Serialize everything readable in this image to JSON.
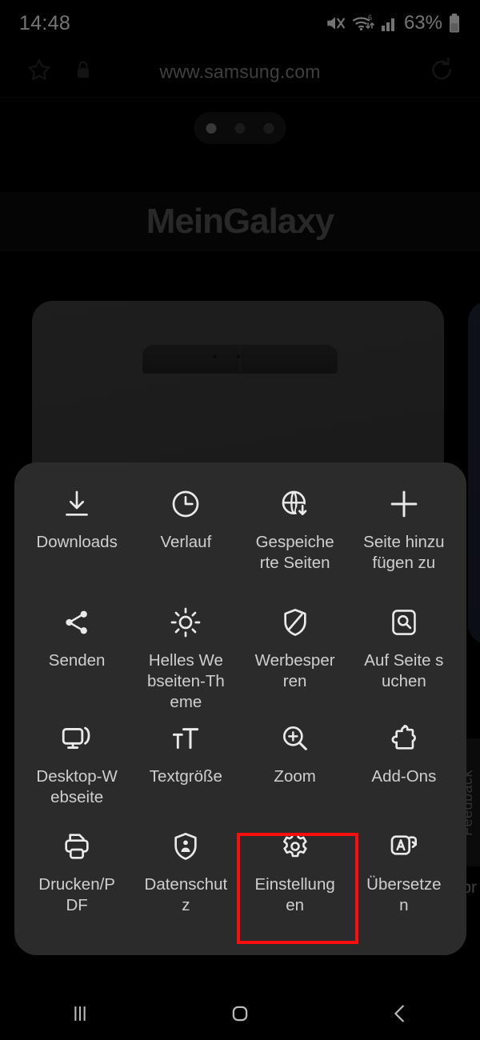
{
  "status_bar": {
    "clock": "14:48",
    "battery_percent": "63%",
    "icons": [
      "mute-icon",
      "wifi-6-icon",
      "signal-bars-icon",
      "battery-icon"
    ]
  },
  "browser_bar": {
    "bookmark_icon": "star-icon",
    "security_icon": "lock-icon",
    "url": "www.samsung.com",
    "reload_icon": "reload-icon"
  },
  "page": {
    "carousel_dots": 3,
    "active_dot_index": 0,
    "brand": "MeinGalaxy",
    "feedback_tab": "Feedback",
    "snippet": "pr"
  },
  "menu": {
    "rows": [
      [
        {
          "label": "Downloads",
          "icon": "download-icon"
        },
        {
          "label": "Verlauf",
          "icon": "history-clock-icon"
        },
        {
          "label": "Gespeicherte Seiten",
          "icon": "globe-download-icon"
        },
        {
          "label": "Seite hinzufügen zu",
          "icon": "plus-icon"
        }
      ],
      [
        {
          "label": "Senden",
          "icon": "share-icon"
        },
        {
          "label": "Helles Webseiten-Theme",
          "icon": "sun-brightness-icon"
        },
        {
          "label": "Werbesperren",
          "icon": "shield-block-icon"
        },
        {
          "label": "Auf Seite suchen",
          "icon": "find-in-page-icon"
        }
      ],
      [
        {
          "label": "Desktop-Webseite",
          "icon": "desktop-monitor-icon"
        },
        {
          "label": "Textgröße",
          "icon": "text-size-icon"
        },
        {
          "label": "Zoom",
          "icon": "zoom-in-icon"
        },
        {
          "label": "Add-Ons",
          "icon": "puzzle-piece-icon"
        }
      ],
      [
        {
          "label": "Drucken/PDF",
          "icon": "printer-icon"
        },
        {
          "label": "Datenschutz",
          "icon": "shield-person-icon"
        },
        {
          "label": "Einstellungen",
          "icon": "gear-icon"
        },
        {
          "label": "Übersetzen",
          "icon": "translate-icon"
        }
      ]
    ],
    "highlighted_item": "Einstellungen",
    "highlight_color": "#fd0d0d"
  },
  "nav_bar": {
    "recents_icon": "recents-icon",
    "home_icon": "home-icon",
    "back_icon": "back-icon"
  },
  "colors": {
    "panel_bg": "#2b2b2b",
    "screen_bg": "#000000",
    "label_text": "#cfcfcf",
    "url_text": "#8d8d8d",
    "highlight": "#fd0d0d"
  }
}
